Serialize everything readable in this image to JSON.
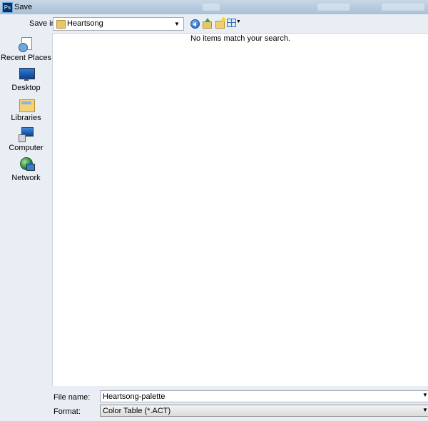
{
  "window": {
    "title": "Save",
    "app_icon": "Ps"
  },
  "toolbar": {
    "save_in_label": "Save in:",
    "save_in_value": "Heartsong"
  },
  "places": [
    {
      "id": "recent",
      "label": "Recent Places",
      "icon": "recent-places-icon"
    },
    {
      "id": "desktop",
      "label": "Desktop",
      "icon": "desktop-icon"
    },
    {
      "id": "libraries",
      "label": "Libraries",
      "icon": "libraries-icon"
    },
    {
      "id": "computer",
      "label": "Computer",
      "icon": "computer-icon"
    },
    {
      "id": "network",
      "label": "Network",
      "icon": "network-icon"
    }
  ],
  "filelist": {
    "empty_message": "No items match your search."
  },
  "fields": {
    "file_name_label": "File name:",
    "file_name_value": "Heartsong-palette",
    "format_label": "Format:",
    "format_value": "Color Table (*.ACT)"
  }
}
